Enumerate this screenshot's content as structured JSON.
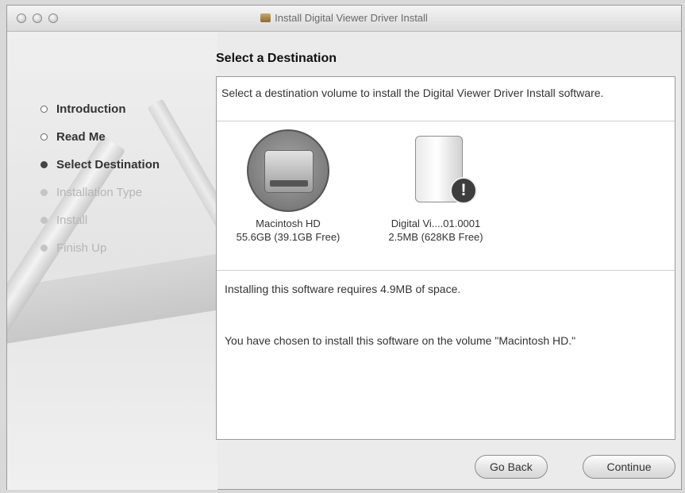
{
  "window": {
    "title": "Install Digital Viewer Driver Install",
    "controls": [
      "close-button",
      "minimize-button",
      "zoom-button"
    ]
  },
  "sidebar": {
    "steps": [
      {
        "label": "Introduction",
        "state": "done"
      },
      {
        "label": "Read Me",
        "state": "done"
      },
      {
        "label": "Select Destination",
        "state": "current"
      },
      {
        "label": "Installation Type",
        "state": "future"
      },
      {
        "label": "Install",
        "state": "future"
      },
      {
        "label": "Finish Up",
        "state": "future"
      }
    ]
  },
  "main": {
    "heading": "Select a Destination",
    "description": "Select a destination volume to install the Digital Viewer Driver Install software.",
    "volumes": [
      {
        "name": "Macintosh HD",
        "size": "55.6GB (39.1GB Free)",
        "icon": "hard-drive-icon",
        "selected": true
      },
      {
        "name": "Digital Vi....01.0001",
        "size": "2.5MB (628KB Free)",
        "icon": "disk-warning-icon",
        "selected": false
      }
    ],
    "requirement": "Installing this software requires 4.9MB of space.",
    "choice": "You have chosen to install this software on the volume \"Macintosh HD.\""
  },
  "buttons": {
    "go_back": "Go Back",
    "continue": "Continue"
  }
}
